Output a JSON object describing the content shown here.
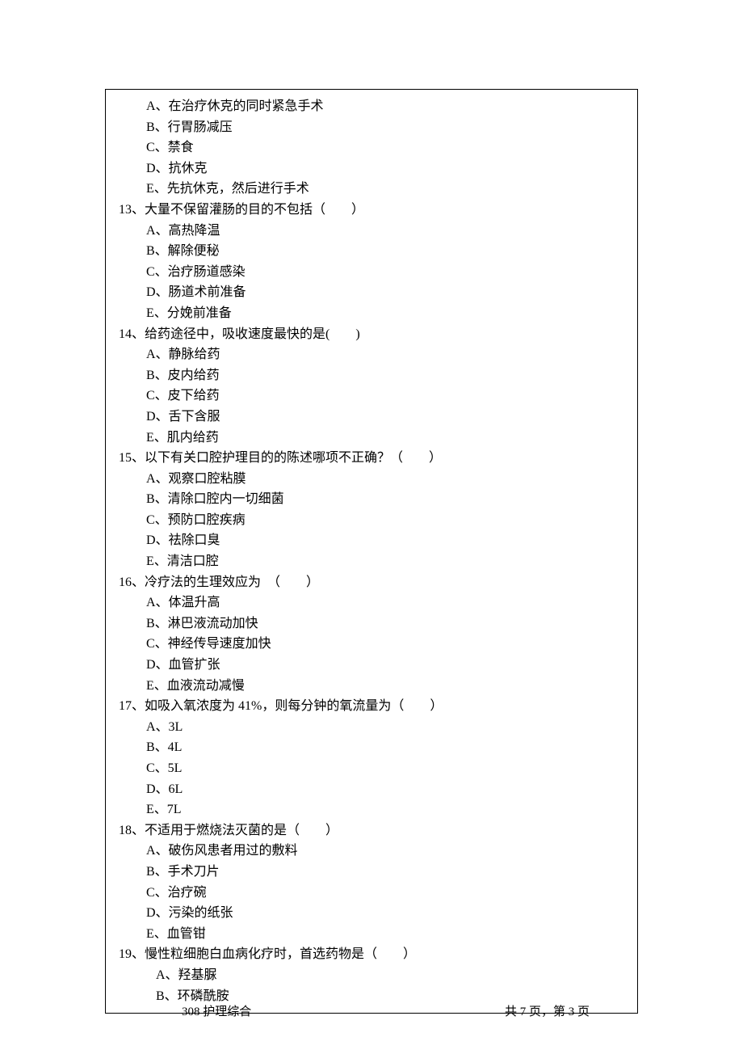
{
  "q12_continued": {
    "options": [
      "A、在治疗休克的同时紧急手术",
      "B、行胃肠减压",
      "C、禁食",
      "D、抗休克",
      "E、先抗休克，然后进行手术"
    ]
  },
  "questions": [
    {
      "number": "13",
      "text": "13、大量不保留灌肠的目的不包括（　　）",
      "options": [
        "A、高热降温",
        "B、解除便秘",
        "C、治疗肠道感染",
        "D、肠道术前准备",
        "E、分娩前准备"
      ]
    },
    {
      "number": "14",
      "text": "14、给药途径中，吸收速度最快的是(　　)",
      "options": [
        "A、静脉给药",
        "B、皮内给药",
        "C、皮下给药",
        "D、舌下含服",
        "E、肌内给药"
      ]
    },
    {
      "number": "15",
      "text": "15、以下有关口腔护理目的的陈述哪项不正确？（　　）",
      "options": [
        "A、观察口腔粘膜",
        "B、清除口腔内一切细菌",
        "C、预防口腔疾病",
        "D、祛除口臭",
        "E、清洁口腔"
      ]
    },
    {
      "number": "16",
      "text": "16、冷疗法的生理效应为　（　　）",
      "options": [
        "A、体温升高",
        "B、淋巴液流动加快",
        "C、神经传导速度加快",
        "D、血管扩张",
        "E、血液流动减慢"
      ]
    },
    {
      "number": "17",
      "text": "17、如吸入氧浓度为 41%，则每分钟的氧流量为（　　）",
      "options": [
        "A、3L",
        "B、4L",
        "C、5L",
        "D、6L",
        "E、7L"
      ]
    },
    {
      "number": "18",
      "text": "18、不适用于燃烧法灭菌的是（　　）",
      "options": [
        "A、破伤风患者用过的敷料",
        "B、手术刀片",
        "C、治疗碗",
        "D、污染的纸张",
        "E、血管钳"
      ]
    },
    {
      "number": "19",
      "text": "19、慢性粒细胞白血病化疗时，首选药物是（　　）",
      "options_indent": true,
      "options": [
        "A、羟基脲",
        "B、环磷酰胺"
      ]
    }
  ],
  "footer": {
    "left": "308 护理综合",
    "right": "共 7 页，第 3 页"
  }
}
